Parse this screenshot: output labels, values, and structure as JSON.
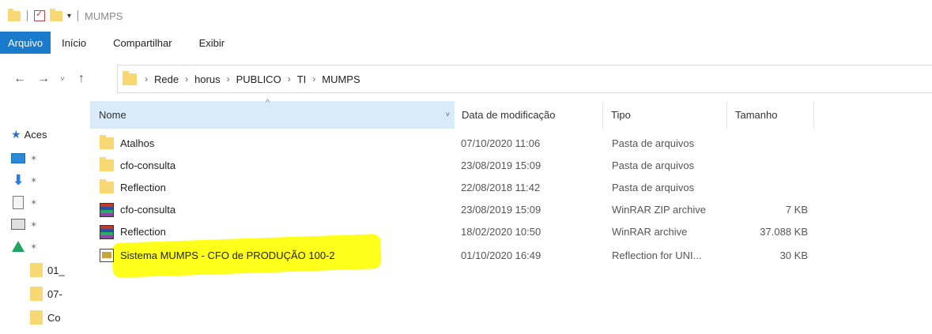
{
  "window": {
    "title": "MUMPS",
    "qa_dropdown": "▾"
  },
  "ribbon": {
    "tabs": [
      {
        "label": "Arquivo",
        "active": true
      },
      {
        "label": "Início",
        "active": false
      },
      {
        "label": "Compartilhar",
        "active": false
      },
      {
        "label": "Exibir",
        "active": false
      }
    ]
  },
  "navigation": {
    "back": "←",
    "forward": "→",
    "recent": "˅",
    "up": "↑"
  },
  "address": {
    "crumb_sep": "›",
    "crumbs": [
      "Rede",
      "horus",
      "PUBLICO",
      "TI",
      "MUMPS"
    ]
  },
  "navpane": {
    "items": [
      {
        "label": "Aces",
        "icon": "star-icon"
      },
      {
        "label": "",
        "icon": "desktop-icon"
      },
      {
        "label": "",
        "icon": "download-icon"
      },
      {
        "label": "",
        "icon": "document-icon"
      },
      {
        "label": "",
        "icon": "picture-icon"
      },
      {
        "label": "",
        "icon": "drive-icon"
      },
      {
        "label": "01_",
        "icon": "folder-icon"
      },
      {
        "label": "07-",
        "icon": "folder-icon"
      },
      {
        "label": "Co",
        "icon": "folder-icon"
      }
    ],
    "pin": "✶"
  },
  "columns": {
    "name": "Nome",
    "date": "Data de modificação",
    "type": "Tipo",
    "size": "Tamanho",
    "sort_arrow": "^",
    "chevron": "˅"
  },
  "files": [
    {
      "name": "Atalhos",
      "date": "07/10/2020 11:06",
      "type": "Pasta de arquivos",
      "size": "",
      "icon": "folder-icon"
    },
    {
      "name": "cfo-consulta",
      "date": "23/08/2019 15:09",
      "type": "Pasta de arquivos",
      "size": "",
      "icon": "folder-icon"
    },
    {
      "name": "Reflection",
      "date": "22/08/2018 11:42",
      "type": "Pasta de arquivos",
      "size": "",
      "icon": "folder-icon"
    },
    {
      "name": "cfo-consulta",
      "date": "23/08/2019 15:09",
      "type": "WinRAR ZIP archive",
      "size": "7 KB",
      "icon": "winrar-icon"
    },
    {
      "name": "Reflection",
      "date": "18/02/2020 10:50",
      "type": "WinRAR archive",
      "size": "37.088 KB",
      "icon": "winrar-icon"
    },
    {
      "name": "Sistema MUMPS - CFO de PRODUÇÃO 100-2",
      "date": "01/10/2020 16:49",
      "type": "Reflection for UNI...",
      "size": "30 KB",
      "icon": "terminal-icon"
    }
  ],
  "colors": {
    "accent": "#1979ca",
    "highlight": "#ffff1c",
    "folder": "#f8d775",
    "header_selected": "#d9ebf9"
  }
}
